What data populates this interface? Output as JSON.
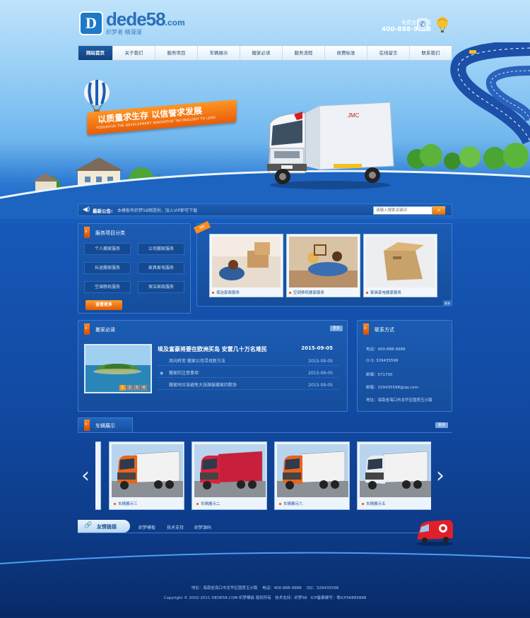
{
  "header": {
    "logo_mark": "D",
    "logo_word": "dede58",
    "logo_suffix": ".com",
    "logo_slogan": "织梦者 精漫漫",
    "hotline_label": "免费咨询热线",
    "hotline_number": "400-888-9988"
  },
  "nav": {
    "items": [
      "网站首页",
      "关于我们",
      "服务项目",
      "车辆展示",
      "搬家必读",
      "服务流程",
      "收费标准",
      "在线留言",
      "联系我们"
    ]
  },
  "banner": {
    "slogan": "以质量求生存  以信誉求发展",
    "slogan_en": "TOSURVIVE THE DEVELOPMENT INNOVATIVE TECHNOLOGY TO LEAD"
  },
  "notice": {
    "title": "最新公告:",
    "text": "本模板有织梦58网提供，加入VIP即可下载",
    "search_placeholder": "请输入搜索关键词"
  },
  "services": {
    "title": "服务项目分类",
    "items": [
      "个人搬家服务",
      "公司搬家服务",
      "长途搬家服务",
      "家具家电服务",
      "空调移机服务",
      "保洁家政服务"
    ],
    "more_label": "查看更多"
  },
  "recommend": {
    "tag": "推荐",
    "items": [
      {
        "caption": "保洁家政服务"
      },
      {
        "caption": "空调移机搬家服务"
      },
      {
        "caption": "家具家电搬家服务"
      }
    ],
    "more_label": "更多"
  },
  "articles": {
    "title": "搬家必读",
    "more_label": "更多",
    "headline": {
      "text": "埃及富豪将要在欧洲买岛 安置几十万名难民",
      "date": "2015-09-05"
    },
    "rows": [
      {
        "text": "风向转变 搬家公司寻找新方法",
        "date": "2015-09-05"
      },
      {
        "text": "搬家的注意事项",
        "date": "2015-09-05"
      },
      {
        "text": "搬家时应该避免大张旗鼓搬家的默协",
        "date": "2015-09-05"
      }
    ],
    "pager": [
      "1",
      "2",
      "3",
      "4"
    ]
  },
  "contact": {
    "title": "联系方式",
    "lines": [
      "电话：400-888-9988",
      "Q  Q: 329435596",
      "邮编：571700",
      "邮箱：329435598@qq.com",
      "地址：海南省海口市龙华区国贸玉沙路"
    ]
  },
  "vehicles": {
    "title": "车辆展示",
    "more_label": "更多",
    "items": [
      {
        "caption": "车辆展示三",
        "color": "#e8641c"
      },
      {
        "caption": "车辆展示二",
        "color": "#d8213a"
      },
      {
        "caption": "车辆展示六",
        "color": "#e8641c"
      },
      {
        "caption": "车辆展示五",
        "color": "#e9eef5"
      }
    ],
    "prev_label": "‹",
    "next_label": "›"
  },
  "links": {
    "title": "友情链接",
    "items": [
      "织梦模板",
      "技术支持",
      "织梦源码"
    ]
  },
  "footer": {
    "line1": "地址：海南省海口市龙华区国贸玉沙路    电话：400-888-9988    QQ：329435596",
    "line2": "Copyright © 2002-2011 DEDE58.COM 织梦模板 版权所有   技术支持：织梦58   ICP备案编号：粤ICP56885888"
  },
  "colors": {
    "accent_orange": "#ff8a26",
    "panel_blue": "#1b5cb3",
    "nav_active": "#1c5ea7"
  }
}
